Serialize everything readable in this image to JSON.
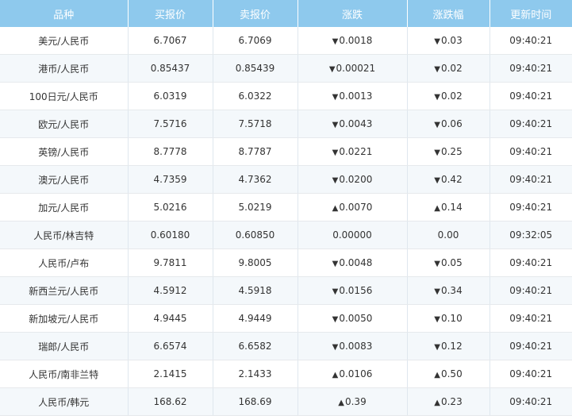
{
  "colors": {
    "header_bg": "#8ec9ed",
    "down": "#1e8f2d",
    "up": "#d61f1f"
  },
  "icons": {
    "down": "down-triangle-icon",
    "up": "up-triangle-icon"
  },
  "table": {
    "columns": [
      "品种",
      "买报价",
      "卖报价",
      "涨跌",
      "涨跌幅",
      "更新时间"
    ],
    "rows": [
      {
        "pair": "美元/人民币",
        "bid": "6.7067",
        "ask": "6.7069",
        "dir": "down",
        "change": "0.0018",
        "pct": "0.03",
        "time": "09:40:21"
      },
      {
        "pair": "港币/人民币",
        "bid": "0.85437",
        "ask": "0.85439",
        "dir": "down",
        "change": "0.00021",
        "pct": "0.02",
        "time": "09:40:21"
      },
      {
        "pair": "100日元/人民币",
        "bid": "6.0319",
        "ask": "6.0322",
        "dir": "down",
        "change": "0.0013",
        "pct": "0.02",
        "time": "09:40:21"
      },
      {
        "pair": "欧元/人民币",
        "bid": "7.5716",
        "ask": "7.5718",
        "dir": "down",
        "change": "0.0043",
        "pct": "0.06",
        "time": "09:40:21"
      },
      {
        "pair": "英镑/人民币",
        "bid": "8.7778",
        "ask": "8.7787",
        "dir": "down",
        "change": "0.0221",
        "pct": "0.25",
        "time": "09:40:21"
      },
      {
        "pair": "澳元/人民币",
        "bid": "4.7359",
        "ask": "4.7362",
        "dir": "down",
        "change": "0.0200",
        "pct": "0.42",
        "time": "09:40:21"
      },
      {
        "pair": "加元/人民币",
        "bid": "5.0216",
        "ask": "5.0219",
        "dir": "up",
        "change": "0.0070",
        "pct": "0.14",
        "time": "09:40:21"
      },
      {
        "pair": "人民币/林吉特",
        "bid": "0.60180",
        "ask": "0.60850",
        "dir": "flat",
        "change": "0.00000",
        "pct": "0.00",
        "time": "09:32:05"
      },
      {
        "pair": "人民币/卢布",
        "bid": "9.7811",
        "ask": "9.8005",
        "dir": "down",
        "change": "0.0048",
        "pct": "0.05",
        "time": "09:40:21"
      },
      {
        "pair": "新西兰元/人民币",
        "bid": "4.5912",
        "ask": "4.5918",
        "dir": "down",
        "change": "0.0156",
        "pct": "0.34",
        "time": "09:40:21"
      },
      {
        "pair": "新加坡元/人民币",
        "bid": "4.9445",
        "ask": "4.9449",
        "dir": "down",
        "change": "0.0050",
        "pct": "0.10",
        "time": "09:40:21"
      },
      {
        "pair": "瑞郎/人民币",
        "bid": "6.6574",
        "ask": "6.6582",
        "dir": "down",
        "change": "0.0083",
        "pct": "0.12",
        "time": "09:40:21"
      },
      {
        "pair": "人民币/南非兰特",
        "bid": "2.1415",
        "ask": "2.1433",
        "dir": "up",
        "change": "0.0106",
        "pct": "0.50",
        "time": "09:40:21"
      },
      {
        "pair": "人民币/韩元",
        "bid": "168.62",
        "ask": "168.69",
        "dir": "up",
        "change": "0.39",
        "pct": "0.23",
        "time": "09:40:21"
      }
    ]
  }
}
